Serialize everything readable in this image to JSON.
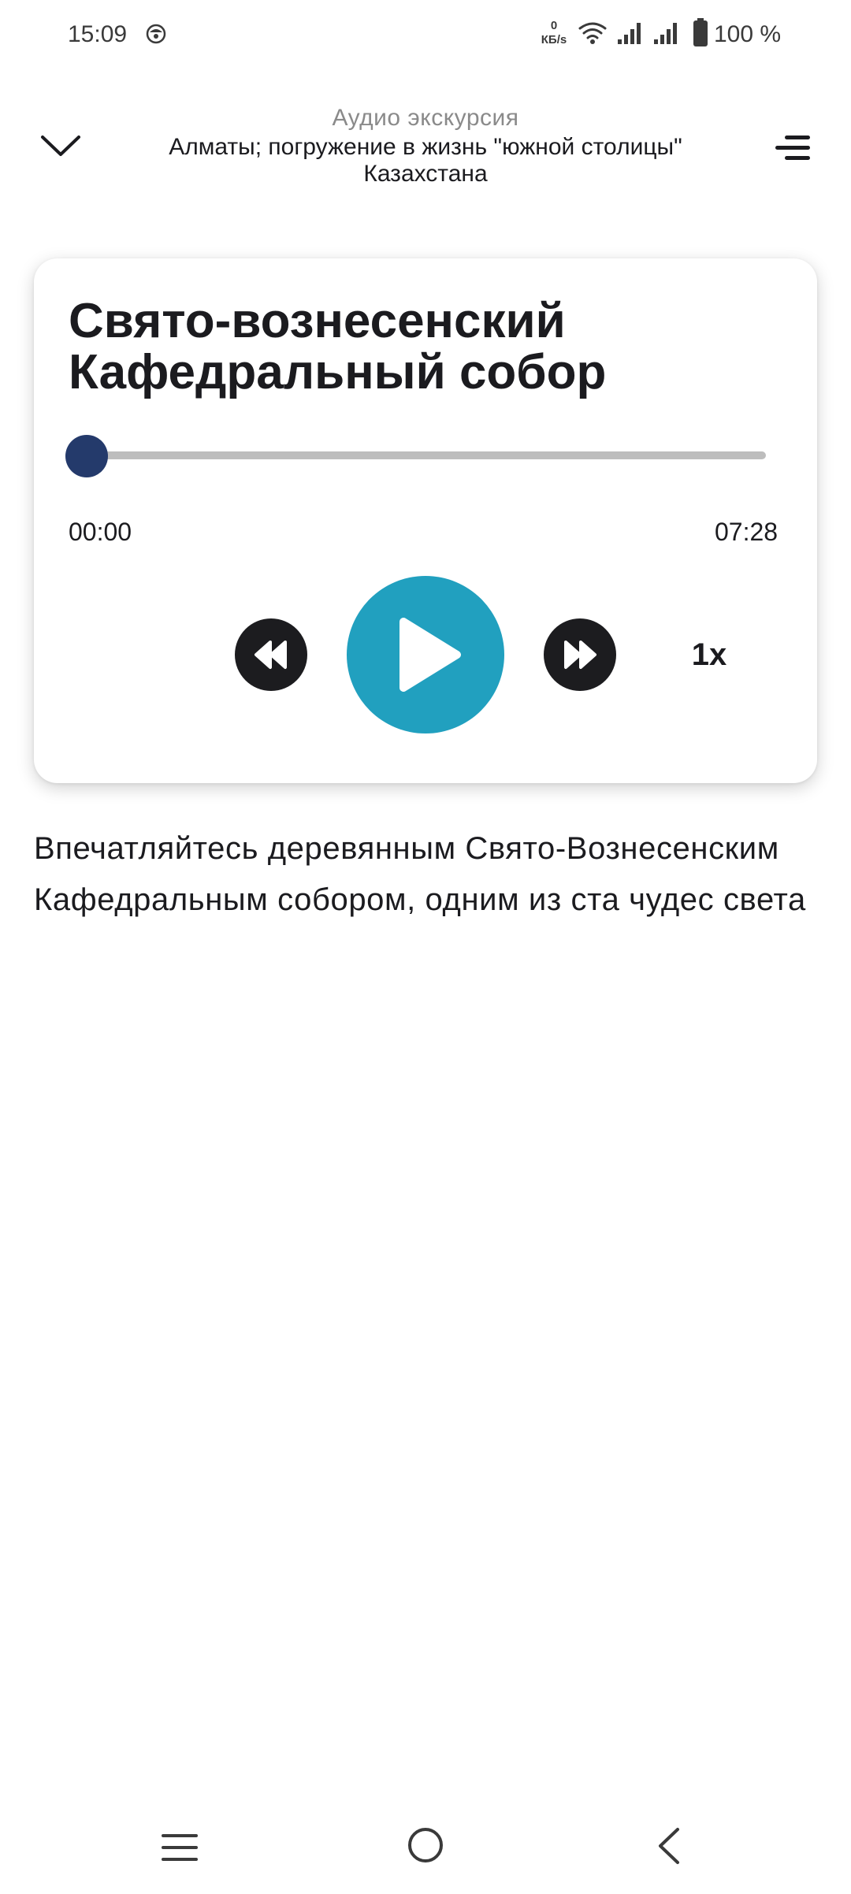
{
  "status_bar": {
    "time": "15:09",
    "net_speed_value": "0",
    "net_speed_unit": "КБ/s",
    "battery_text": "100 %",
    "icons": [
      "face-notification-icon",
      "wifi-icon",
      "signal-icon",
      "signal-icon",
      "battery-icon"
    ]
  },
  "header": {
    "subtitle": "Аудио экскурсия",
    "title": "Алматы; погружение в жизнь \"южной столицы\" Казахстана",
    "left_icon": "chevron-down-icon",
    "right_icon": "menu-icon"
  },
  "player": {
    "track_title": "Свято-вознесенский Кафедральный собор",
    "current_time": "00:00",
    "total_time": "07:28",
    "progress_fraction": 0,
    "speed_label": "1x",
    "controls": [
      "rewind-icon",
      "play-icon",
      "fast-forward-icon"
    ]
  },
  "description": "Впечатляйтесь деревянным Свято-Вознесенским Кафедральным собором, одним из ста чудес света",
  "colors": {
    "accent_play": "#21a0bf",
    "progress_knob": "#243a6b",
    "track": "#bdbdbd",
    "control_dark": "#1c1c1f"
  },
  "nav_bar": {
    "icons": [
      "recents-icon",
      "home-icon",
      "back-icon"
    ]
  }
}
